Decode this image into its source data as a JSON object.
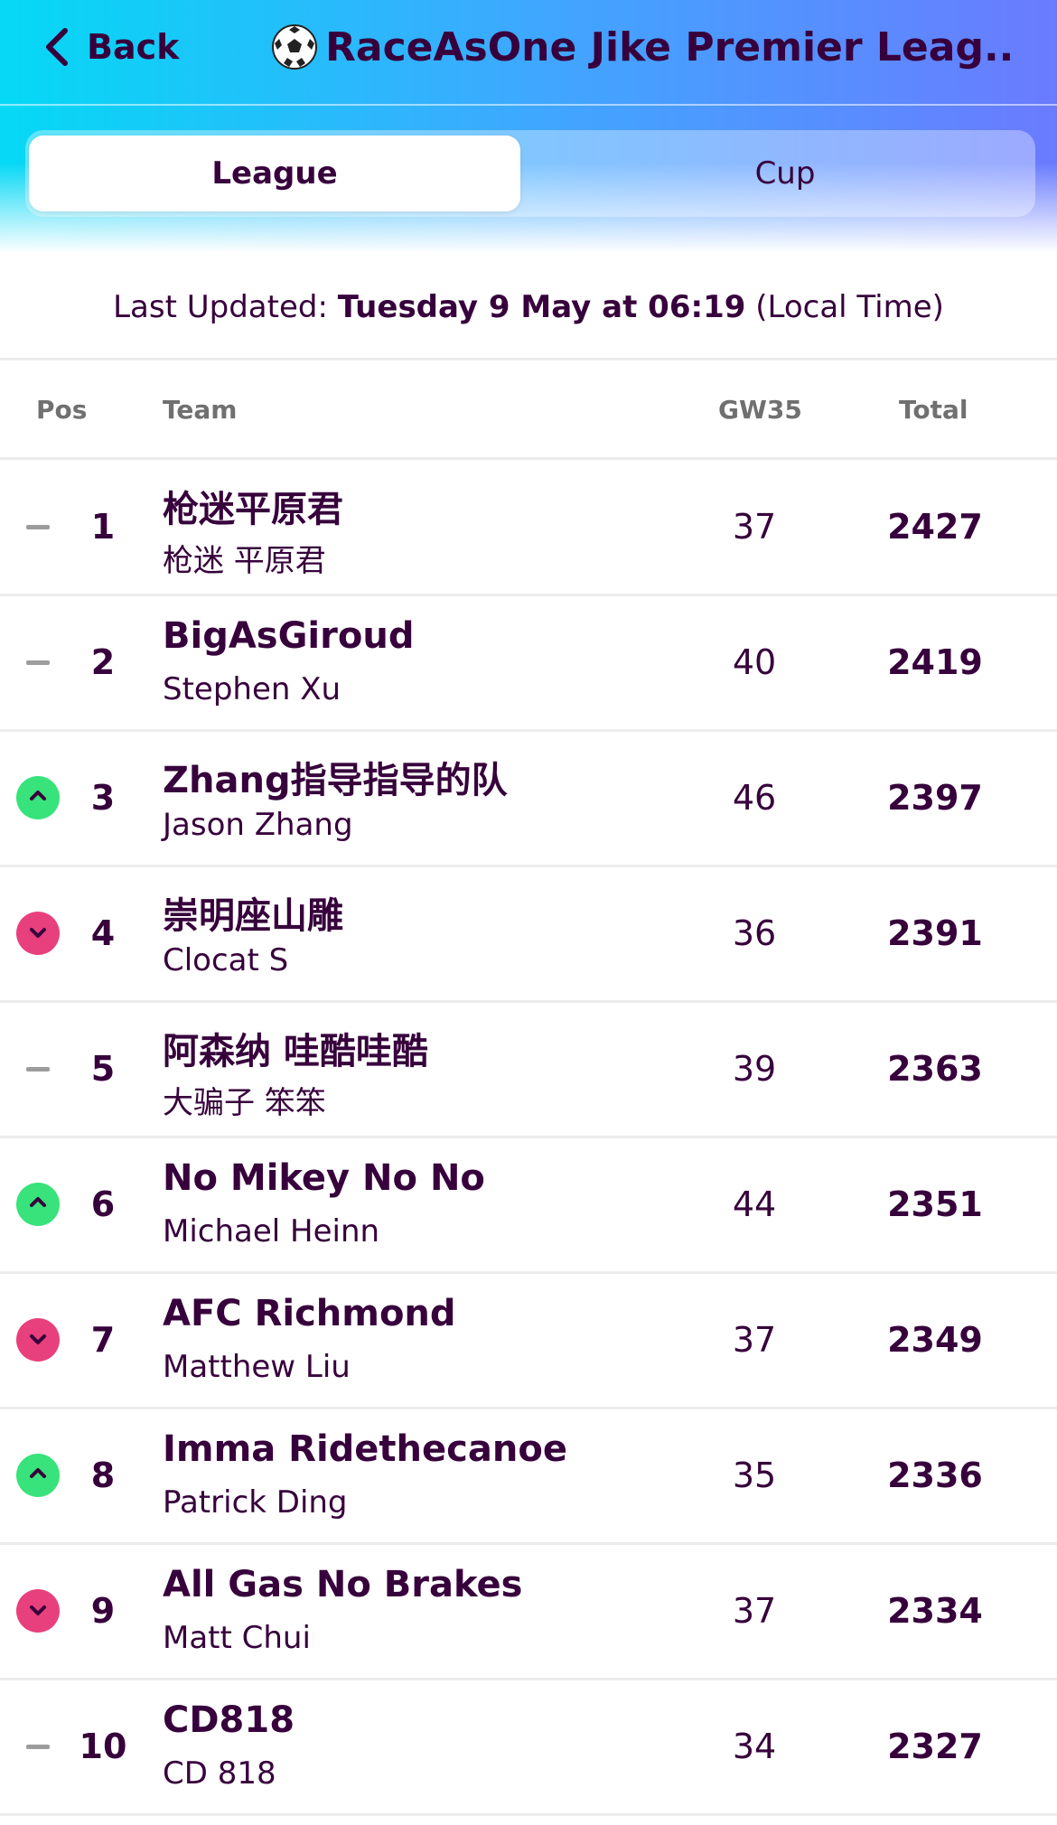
{
  "header": {
    "back_label": "Back",
    "title": "RaceAsOne Jike Premier Leag...",
    "title_icon": "soccer-ball-icon"
  },
  "tabs": [
    {
      "label": "League",
      "active": true
    },
    {
      "label": "Cup",
      "active": false
    }
  ],
  "last_updated": {
    "prefix": "Last Updated: ",
    "value": "Tuesday 9 May at 06:19",
    "suffix": " (Local Time)"
  },
  "table": {
    "columns": {
      "pos": "Pos",
      "team": "Team",
      "gw": "GW35",
      "total": "Total"
    },
    "rows": [
      {
        "movement": "same",
        "pos": "1",
        "team": "枪迷平原君",
        "manager": "枪迷 平原君",
        "gw": "37",
        "total": "2427"
      },
      {
        "movement": "same",
        "pos": "2",
        "team": "BigAsGiroud",
        "manager": "Stephen Xu",
        "gw": "40",
        "total": "2419"
      },
      {
        "movement": "up",
        "pos": "3",
        "team": "Zhang指导指导的队",
        "manager": "Jason Zhang",
        "gw": "46",
        "total": "2397"
      },
      {
        "movement": "down",
        "pos": "4",
        "team": "崇明座山雕",
        "manager": "Clocat S",
        "gw": "36",
        "total": "2391"
      },
      {
        "movement": "same",
        "pos": "5",
        "team": "阿森纳 哇酷哇酷",
        "manager": "大骗子 笨笨",
        "gw": "39",
        "total": "2363"
      },
      {
        "movement": "up",
        "pos": "6",
        "team": "No Mikey No No",
        "manager": "Michael Heinn",
        "gw": "44",
        "total": "2351"
      },
      {
        "movement": "down",
        "pos": "7",
        "team": "AFC Richmond",
        "manager": "Matthew Liu",
        "gw": "37",
        "total": "2349"
      },
      {
        "movement": "up",
        "pos": "8",
        "team": "Imma Ridethecanoe",
        "manager": "Patrick Ding",
        "gw": "35",
        "total": "2336"
      },
      {
        "movement": "down",
        "pos": "9",
        "team": "All Gas No Brakes",
        "manager": "Matt Chui",
        "gw": "37",
        "total": "2334"
      },
      {
        "movement": "same",
        "pos": "10",
        "team": "CD818",
        "manager": "CD 818",
        "gw": "34",
        "total": "2327"
      }
    ]
  },
  "colors": {
    "text": "#37003c",
    "up": "#37e37a",
    "down": "#e8407d",
    "header_start": "#05d9f5",
    "header_end": "#6a7bff"
  }
}
